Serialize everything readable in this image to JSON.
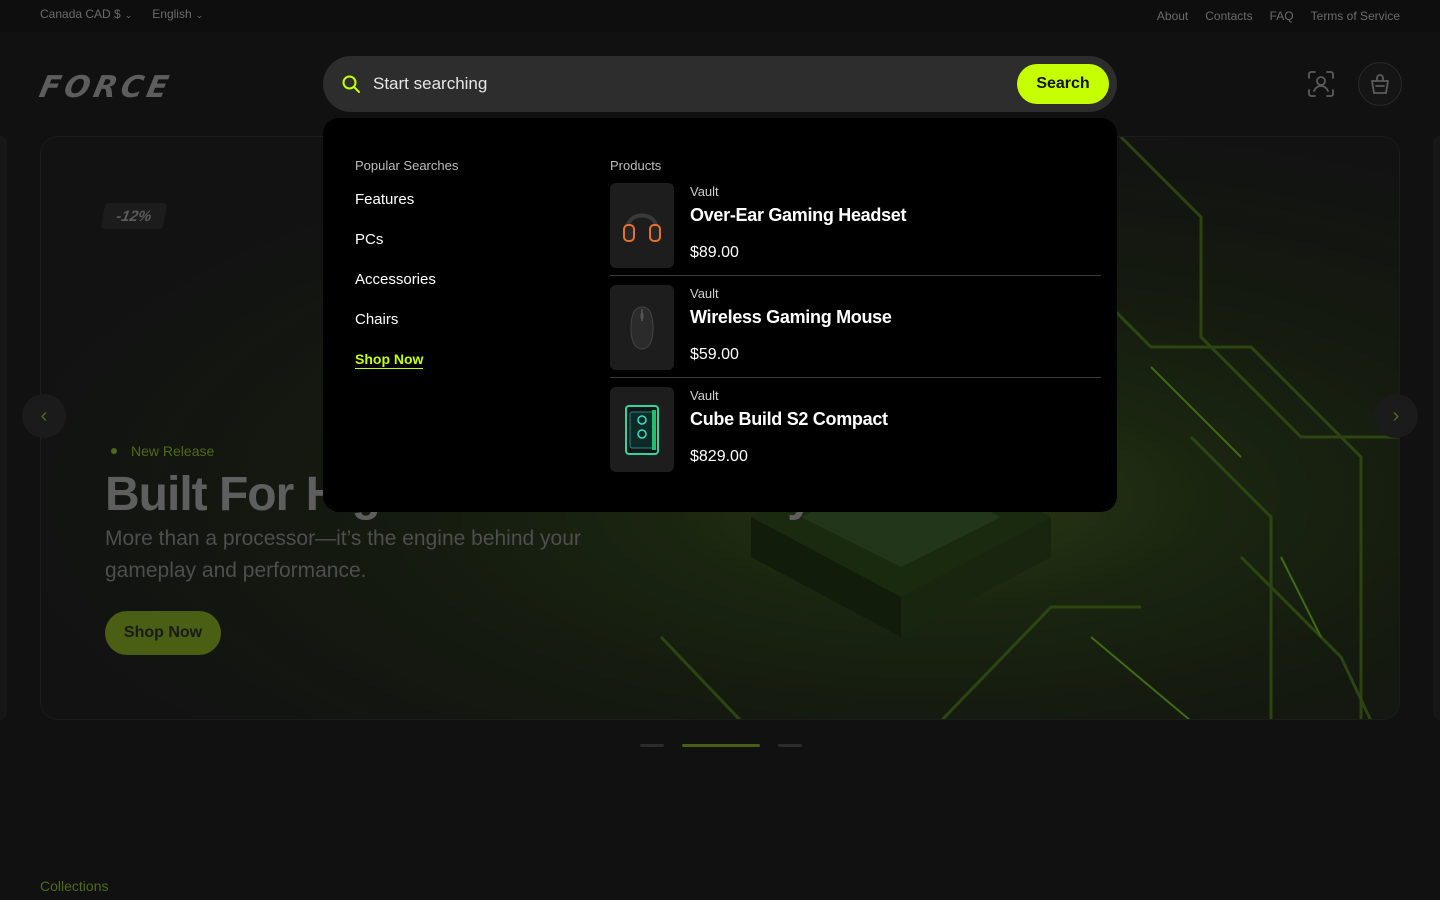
{
  "topbar": {
    "currency": "Canada CAD $",
    "language": "English",
    "links": [
      "About",
      "Contacts",
      "FAQ",
      "Terms of Service"
    ]
  },
  "header": {
    "logo": "FORCE",
    "icons": [
      "user-scan-icon",
      "cart-icon"
    ]
  },
  "search": {
    "placeholder": "Start searching",
    "button_label": "Search"
  },
  "dropdown": {
    "popular_heading": "Popular Searches",
    "popular": [
      "Features",
      "PCs",
      "Accessories",
      "Chairs"
    ],
    "shop_now": "Shop Now",
    "products_heading": "Products",
    "products": [
      {
        "vendor": "Vault",
        "name": "Over-Ear Gaming Headset",
        "price": "$89.00",
        "icon": "headset-icon"
      },
      {
        "vendor": "Vault",
        "name": "Wireless Gaming Mouse",
        "price": "$59.00",
        "icon": "mouse-icon"
      },
      {
        "vendor": "Vault",
        "name": "Cube Build S2 Compact",
        "price": "$829.00",
        "icon": "pc-case-icon"
      }
    ]
  },
  "hero": {
    "badge": "-12%",
    "tag": "New Release",
    "title": "Built For High-Performance Play",
    "subtitle": "More than a processor—it’s the engine behind your gameplay and performance.",
    "button_label": "Shop Now"
  },
  "carousel": {
    "slides": 3,
    "active_slide": 2
  },
  "sections": {
    "collections_label": "Collections"
  },
  "colors": {
    "accent": "#c6ff00",
    "background": "#111111",
    "dropdown_bg": "#000000"
  }
}
